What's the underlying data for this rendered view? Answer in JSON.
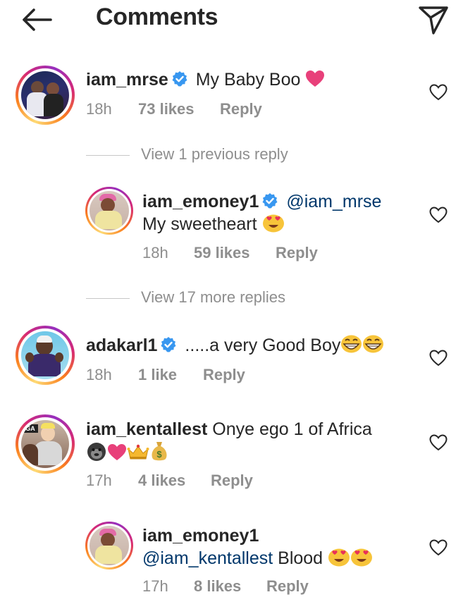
{
  "header": {
    "title": "Comments",
    "back_icon": "arrow-left-icon",
    "share_icon": "paper-plane-icon"
  },
  "colors": {
    "text": "#262626",
    "muted": "#8e8e8e",
    "mention": "#00376b",
    "verified": "#3897f0",
    "heart": "#e8407a"
  },
  "comments": [
    {
      "username": "iam_mrse",
      "verified": true,
      "text": "My Baby Boo",
      "emoji": [
        "pink-heart-emoji"
      ],
      "time": "18h",
      "likes": "73 likes",
      "reply": "Reply"
    },
    {
      "username": "iam_emoney1",
      "verified": true,
      "mention": "@iam_mrse",
      "text": "My sweetheart",
      "emoji": [
        "heart-eyes-emoji"
      ],
      "time": "18h",
      "likes": "59 likes",
      "reply": "Reply"
    },
    {
      "username": "adakarl1",
      "verified": true,
      "text": ".....a very Good Boy",
      "emoji": [
        "grin-emoji",
        "grin-emoji"
      ],
      "time": "18h",
      "likes": "1 like",
      "reply": "Reply"
    },
    {
      "username": "iam_kentallest",
      "verified": false,
      "text": "Onye ego 1 of Africa",
      "emoji": [
        "gorilla-emoji",
        "pink-heart-emoji",
        "crown-emoji",
        "money-bag-emoji"
      ],
      "time": "17h",
      "likes": "4 likes",
      "reply": "Reply"
    },
    {
      "username": "iam_emoney1",
      "verified": false,
      "mention": "@iam_kentallest",
      "text": "Blood",
      "emoji": [
        "heart-eyes-emoji",
        "heart-eyes-emoji"
      ],
      "time": "17h",
      "likes": "8 likes",
      "reply": "Reply"
    }
  ],
  "view_previous": "View 1 previous reply",
  "view_more": "View 17 more replies"
}
